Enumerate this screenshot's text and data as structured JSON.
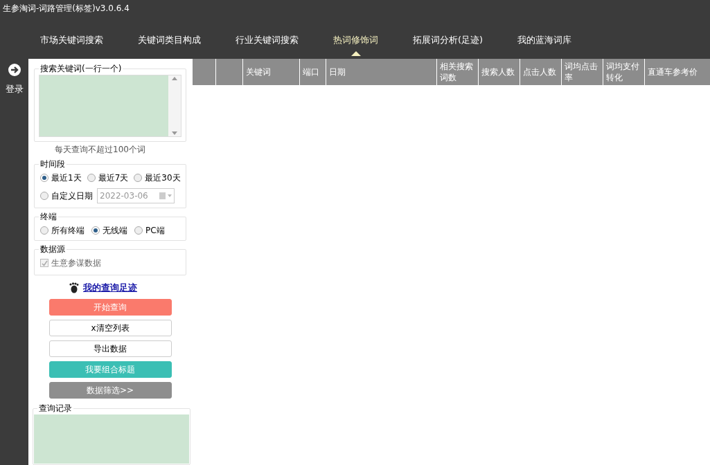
{
  "window": {
    "title": "生参淘词-词路管理(标签)v3.0.6.4"
  },
  "tabs": [
    {
      "label": "市场关键词搜索",
      "selected": false
    },
    {
      "label": "关键词类目构成",
      "selected": false
    },
    {
      "label": "行业关键词搜索",
      "selected": false
    },
    {
      "label": "热词修饰词",
      "selected": true
    },
    {
      "label": "拓展词分析(足迹)",
      "selected": false
    },
    {
      "label": "我的蓝海词库",
      "selected": false
    }
  ],
  "login": {
    "label": "登录"
  },
  "keyword_input": {
    "legend": "搜索关键词(一行一个)",
    "hint": "每天查询不超过100个词"
  },
  "time_range": {
    "legend": "时间段",
    "options": [
      {
        "label": "最近1天",
        "selected": true
      },
      {
        "label": "最近7天",
        "selected": false
      },
      {
        "label": "最近30天",
        "selected": false
      },
      {
        "label": "自定义日期",
        "selected": false
      }
    ],
    "date": {
      "value": "2022-03-06",
      "disabled": true
    }
  },
  "terminal": {
    "legend": "终端",
    "options": [
      {
        "label": "所有终端",
        "selected": false
      },
      {
        "label": "无线端",
        "selected": true
      },
      {
        "label": "PC端",
        "selected": false
      }
    ]
  },
  "data_source": {
    "legend": "数据源",
    "checkbox": {
      "label": "生意参谋数据",
      "checked": true,
      "disabled": true
    }
  },
  "history_link": {
    "label": "我的查询足迹"
  },
  "buttons": [
    {
      "label": "开始查询",
      "kind": "primary"
    },
    {
      "label": "x清空列表",
      "kind": "plain"
    },
    {
      "label": "导出数据",
      "kind": "plain"
    },
    {
      "label": "我要组合标题",
      "kind": "accent"
    },
    {
      "label": "数据筛选>>",
      "kind": "muted"
    }
  ],
  "query_log": {
    "legend": "查询记录"
  },
  "table": {
    "columns": [
      "",
      "",
      "关键词",
      "端口",
      "日期",
      "相关搜索词数",
      "搜索人数",
      "点击人数",
      "词均点击率",
      "词均支付转化",
      "直通车参考价"
    ]
  }
}
